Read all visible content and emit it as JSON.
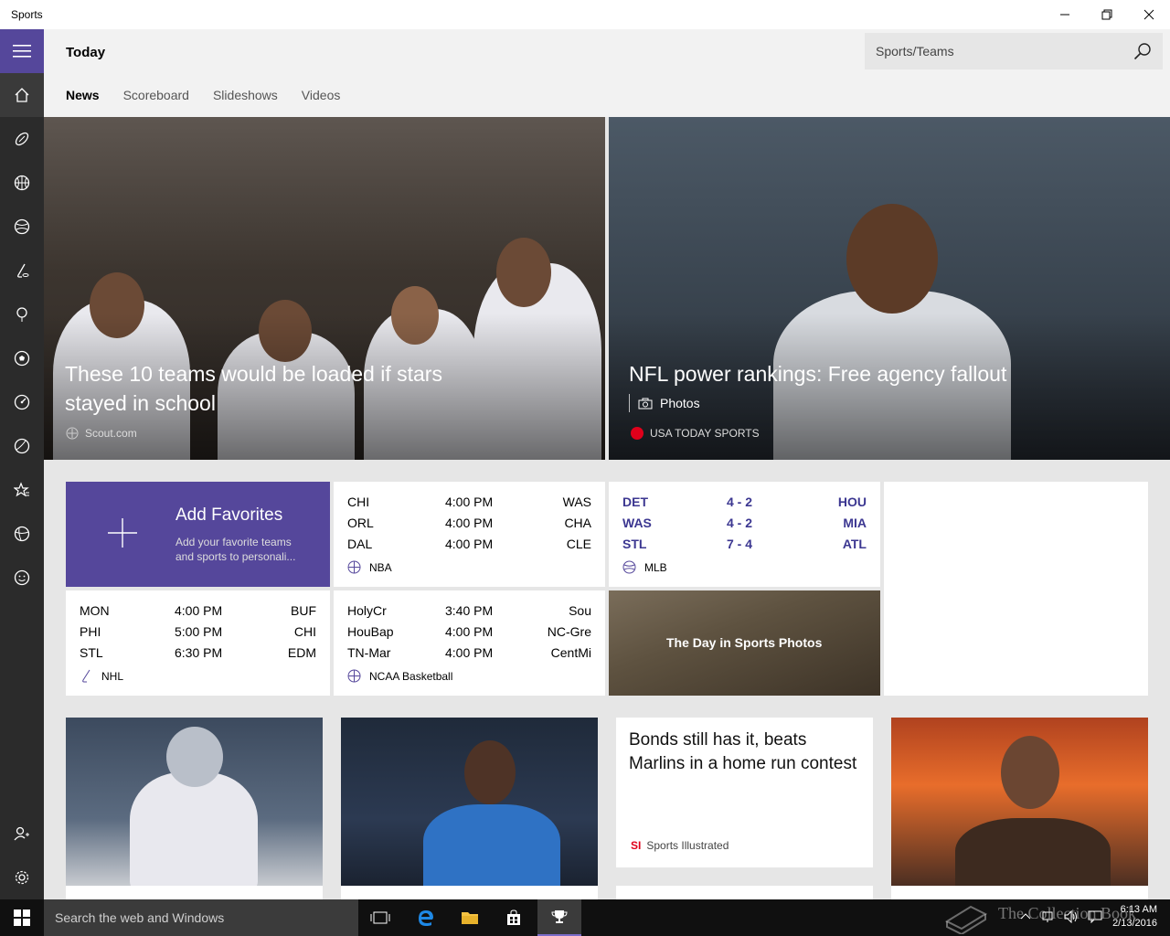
{
  "window": {
    "title": "Sports"
  },
  "nav": {
    "items": [
      "home-icon",
      "football-icon",
      "basketball-icon",
      "baseball-icon",
      "hockey-icon",
      "golf-icon",
      "soccer-icon",
      "motorsports-icon",
      "tennis-icon",
      "favorites-icon",
      "more-sports-icon",
      "fantasy-icon"
    ],
    "bottom": [
      "sign-in-icon",
      "settings-icon"
    ]
  },
  "header": {
    "title": "Today",
    "search_placeholder": "Sports/Teams",
    "tabs": [
      "News",
      "Scoreboard",
      "Slideshows",
      "Videos"
    ]
  },
  "hero": [
    {
      "headline": "These 10 teams would be loaded if stars stayed in school",
      "source": "Scout.com"
    },
    {
      "headline": "NFL power rankings: Free agency fallout",
      "label": "Photos",
      "source": "USA TODAY SPORTS"
    }
  ],
  "favorites": {
    "title": "Add Favorites",
    "desc": "Add your favorite teams and sports to personali..."
  },
  "scores": {
    "nba": {
      "league": "NBA",
      "rows": [
        [
          "CHI",
          "4:00 PM",
          "WAS"
        ],
        [
          "ORL",
          "4:00 PM",
          "CHA"
        ],
        [
          "DAL",
          "4:00 PM",
          "CLE"
        ]
      ]
    },
    "mlb": {
      "league": "MLB",
      "rows": [
        [
          "DET",
          "4 - 2",
          "HOU"
        ],
        [
          "WAS",
          "4 - 2",
          "MIA"
        ],
        [
          "STL",
          "7 - 4",
          "ATL"
        ]
      ]
    },
    "nhl": {
      "league": "NHL",
      "rows": [
        [
          "MON",
          "4:00 PM",
          "BUF"
        ],
        [
          "PHI",
          "5:00 PM",
          "CHI"
        ],
        [
          "STL",
          "6:30 PM",
          "EDM"
        ]
      ]
    },
    "ncaa": {
      "league": "NCAA Basketball",
      "rows": [
        [
          "HolyCr",
          "3:40 PM",
          "Sou"
        ],
        [
          "HouBap",
          "4:00 PM",
          "NC-Gre"
        ],
        [
          "TN-Mar",
          "4:00 PM",
          "CentMi"
        ]
      ]
    }
  },
  "day_photos": {
    "caption": "The Day in Sports Photos"
  },
  "cards": {
    "bonds": {
      "headline": "Bonds still has it, beats Marlins in a home run contest",
      "source": "Sports Illustrated",
      "badge": "SI"
    }
  },
  "taskbar": {
    "search_placeholder": "Search the web and Windows",
    "time": "6:13 AM",
    "date": "2/13/2016",
    "watermark": "The Collection Book"
  },
  "colors": {
    "accent": "#55479b",
    "rail": "#2b2b2b",
    "score_bold": "#3c3791"
  }
}
